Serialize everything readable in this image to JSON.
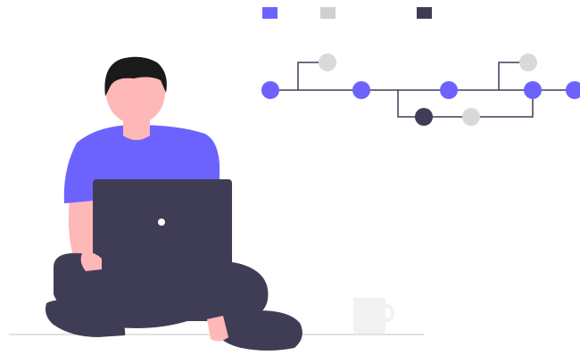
{
  "illustration": {
    "subject": "person-with-laptop",
    "background": "#ffffff"
  },
  "legend": {
    "items": [
      {
        "color": "#6c63ff"
      },
      {
        "color": "#d0d0d0"
      },
      {
        "color": "#3f3d56"
      }
    ]
  },
  "branch_diagram": {
    "line_color": "#3f3d56",
    "main_commit_color": "#6c63ff",
    "side_commit_color": "#d9d9d9",
    "dark_commit_color": "#3f3d56"
  },
  "palette": {
    "skin": "#ffb8b8",
    "hair": "#1a1a1a",
    "shirt": "#6c63ff",
    "pants": "#3f3d56",
    "laptop": "#3f3d56",
    "laptop_light": "#ffffff",
    "floor": "#d9d9d9",
    "mug": "#f2f2f2"
  }
}
